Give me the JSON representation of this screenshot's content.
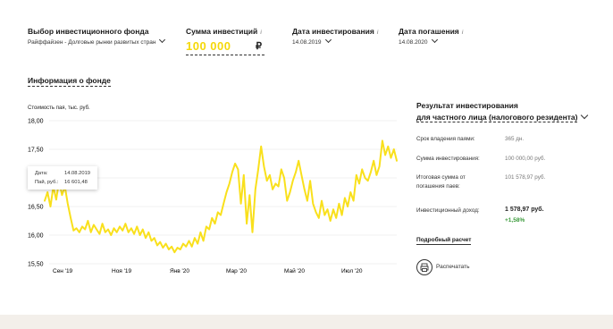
{
  "form": {
    "fund": {
      "label": "Выбор инвестиционного фонда",
      "value": "Райффайзен - Долговые рынки развитых стран"
    },
    "amount": {
      "label": "Сумма инвестиций",
      "value": "100 000",
      "currency": "₽",
      "info_icon": "i"
    },
    "invest_date": {
      "label": "Дата инвестирования",
      "value": "14.08.2019",
      "info_icon": "i"
    },
    "redeem_date": {
      "label": "Дата погашения",
      "value": "14.08.2020",
      "info_icon": "i"
    }
  },
  "info_title": "Информация о фонде",
  "chart_data": {
    "type": "line",
    "ylabel": "Стоимость пая, тыс. руб.",
    "yticks": [
      "18,00",
      "17,50",
      "17,00",
      "16,50",
      "16,00",
      "15,50"
    ],
    "ylim": [
      15.5,
      18.0
    ],
    "xticks": [
      "Сен '19",
      "Ноя '19",
      "Янв '20",
      "Мар '20",
      "Май '20",
      "Июл '20"
    ],
    "grid": true,
    "line_color": "#f9e01c",
    "series": [
      {
        "values": [
          16.6,
          16.75,
          16.5,
          16.85,
          16.62,
          16.95,
          16.7,
          16.85,
          16.55,
          16.3,
          16.08,
          16.12,
          16.05,
          16.15,
          16.1,
          16.25,
          16.05,
          16.18,
          16.1,
          16.02,
          16.2,
          16.05,
          16.1,
          16.0,
          16.12,
          16.05,
          16.15,
          16.08,
          16.2,
          16.05,
          16.12,
          16.02,
          16.15,
          16.0,
          16.1,
          15.95,
          16.05,
          15.9,
          15.95,
          15.82,
          15.88,
          15.78,
          15.85,
          15.75,
          15.8,
          15.7,
          15.78,
          15.75,
          15.85,
          15.8,
          15.9,
          15.8,
          15.95,
          15.85,
          16.05,
          15.9,
          16.15,
          16.1,
          16.3,
          16.2,
          16.4,
          16.35,
          16.55,
          16.75,
          16.9,
          17.1,
          17.25,
          17.15,
          16.55,
          17.05,
          16.2,
          16.7,
          16.05,
          16.8,
          17.15,
          17.55,
          17.2,
          16.95,
          17.05,
          16.8,
          16.9,
          16.85,
          17.15,
          17.0,
          16.6,
          16.75,
          16.95,
          17.1,
          17.3,
          17.05,
          16.8,
          16.6,
          16.95,
          16.55,
          16.4,
          16.3,
          16.6,
          16.35,
          16.45,
          16.25,
          16.45,
          16.3,
          16.55,
          16.35,
          16.65,
          16.5,
          16.75,
          16.6,
          17.05,
          16.9,
          17.15,
          17.0,
          16.95,
          17.1,
          17.3,
          17.05,
          17.2,
          17.65,
          17.4,
          17.55,
          17.35,
          17.5,
          17.3
        ]
      }
    ],
    "tooltip": {
      "date_label": "Дата:",
      "date_value": "14.08.2019",
      "price_label": "Пай, руб.:",
      "price_value": "16 601,48"
    }
  },
  "results": {
    "title_line1": "Результат инвестирования",
    "title_line2": "для частного лица (налогового резидента)",
    "rows": [
      {
        "label": "Срок владения паями:",
        "value": "365 дн."
      },
      {
        "label": "Сумма инвестирования:",
        "value": "100 000,00 руб."
      },
      {
        "label_line1": "Итоговая сумма от",
        "label_line2": "погашения паев:",
        "value": "101 578,97 руб."
      },
      {
        "label": "Инвестиционный доход:",
        "value": "1 578,97 руб.",
        "pct": "+1,58%"
      }
    ],
    "detail_link": "Подробный расчет",
    "print_label": "Распечатать"
  },
  "colors": {
    "accent": "#f5d80a",
    "positive": "#3a9a3a",
    "footer_bg": "#f3efea"
  }
}
